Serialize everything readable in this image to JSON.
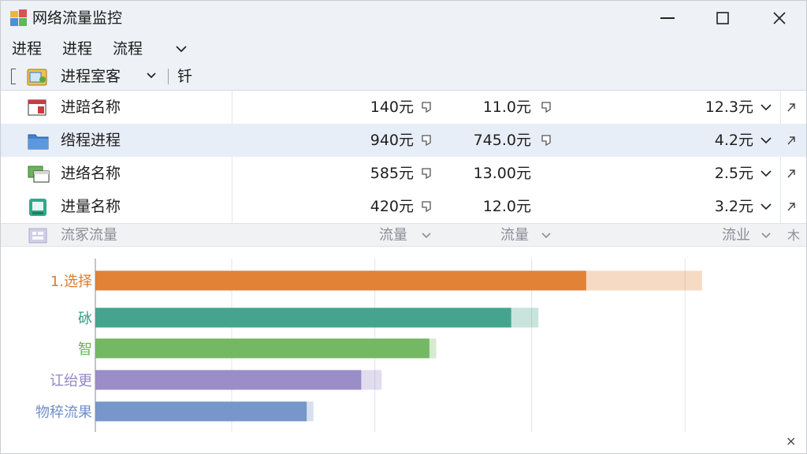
{
  "window": {
    "title": "网络流量监控",
    "controls": {
      "minimize": "—",
      "maximize": "☐",
      "close": "✕"
    }
  },
  "menu": {
    "items": [
      "进程",
      "进程",
      "流程"
    ]
  },
  "toolbar": {
    "view_label": "进程室客",
    "extra_label": "钎"
  },
  "rows": [
    {
      "name": "进踣名称",
      "v1": "140元",
      "v2": "11.0元",
      "v3": "12.3元",
      "icon": "window-red-icon"
    },
    {
      "name": "绺程进程",
      "v1": "940元",
      "v2": "745.0元",
      "v3": "4.2元",
      "icon": "folder-blue-icon"
    },
    {
      "name": "进络名称",
      "v1": "585元",
      "v2": "13.00元",
      "v3": "2.5元",
      "icon": "window-green-icon"
    },
    {
      "name": "进量名称",
      "v1": "420元",
      "v2": "12.0元",
      "v3": "3.2元",
      "icon": "app-teal-icon"
    }
  ],
  "summary": {
    "name": "流冢流量",
    "h1": "流量",
    "h2": "流量",
    "h3": "流业",
    "extra": "木"
  },
  "colors": {
    "orange": "#e07b2a",
    "teal": "#3a9e86",
    "green": "#6cb35a",
    "purple": "#9486c4",
    "blue": "#6f8fc7"
  },
  "chart_data": {
    "type": "bar",
    "orientation": "horizontal",
    "categories": [
      "1.选择",
      "砅",
      "智",
      "讧绐更",
      "物稡流果"
    ],
    "series": [
      {
        "values": [
          0.72,
          0.61,
          0.49,
          0.39,
          0.31
        ]
      },
      {
        "values": [
          0.89,
          0.65,
          0.5,
          0.42,
          0.32
        ]
      }
    ],
    "category_colors": [
      "#e07b2a",
      "#3a9e86",
      "#6cb35a",
      "#9486c4",
      "#6f8fc7"
    ],
    "xlim": [
      0,
      1
    ],
    "grid": true,
    "close_label": "×"
  }
}
